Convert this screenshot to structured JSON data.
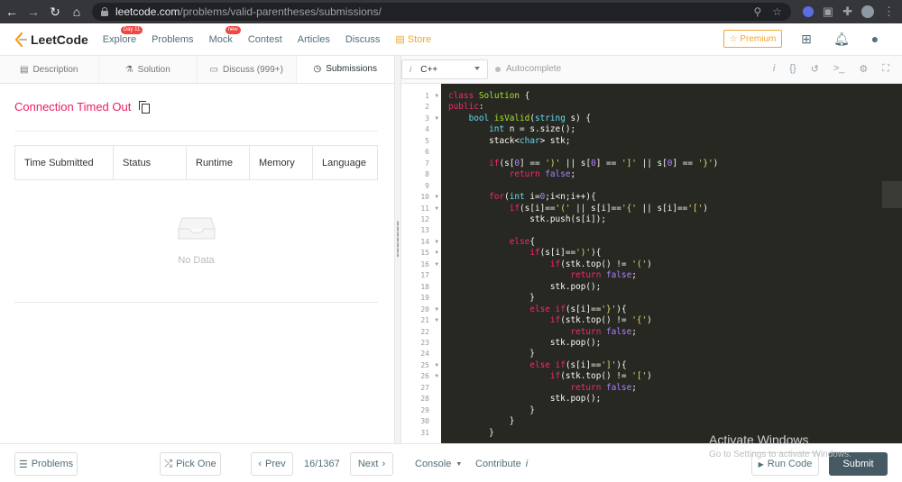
{
  "browser": {
    "url_host": "leetcode.com",
    "url_path": "/problems/valid-parentheses/submissions/"
  },
  "nav": {
    "logo_text": "LeetCode",
    "links": [
      "Explore",
      "Problems",
      "Mock",
      "Contest",
      "Articles",
      "Discuss",
      "Store"
    ],
    "explore_badge": "Day 11",
    "mock_badge": "new",
    "premium_label": "Premium"
  },
  "left_tabs": [
    "Description",
    "Solution",
    "Discuss (999+)",
    "Submissions"
  ],
  "submissions": {
    "status_title": "Connection Timed Out",
    "columns": [
      "Time Submitted",
      "Status",
      "Runtime",
      "Memory",
      "Language"
    ],
    "empty_text": "No Data"
  },
  "editor": {
    "language": "C++",
    "autocomplete_label": "Autocomplete",
    "line_numbers": [
      "1",
      "2",
      "3",
      "4",
      "5",
      "6",
      "7",
      "8",
      "9",
      "10",
      "11",
      "12",
      "13",
      "14",
      "15",
      "16",
      "17",
      "18",
      "19",
      "20",
      "21",
      "22",
      "23",
      "24",
      "25",
      "26",
      "27",
      "28",
      "29",
      "30",
      "31"
    ],
    "fold_lines": [
      "1",
      "3",
      "10",
      "11",
      "14",
      "15",
      "16",
      "20",
      "21",
      "25",
      "26"
    ]
  },
  "footer": {
    "problems_label": "Problems",
    "pick_one_label": "Pick One",
    "prev_label": "Prev",
    "page_indicator": "16/1367",
    "next_label": "Next",
    "console_label": "Console",
    "contribute_label": "Contribute",
    "run_code_label": "Run Code",
    "submit_label": "Submit"
  },
  "watermark": {
    "title": "Activate Windows",
    "subtitle": "Go to Settings to activate Windows."
  },
  "colors": {
    "accent_pink": "#e91e63",
    "store_orange": "#f0a72b",
    "editor_bg": "#272822",
    "submit_bg": "#455a64"
  }
}
